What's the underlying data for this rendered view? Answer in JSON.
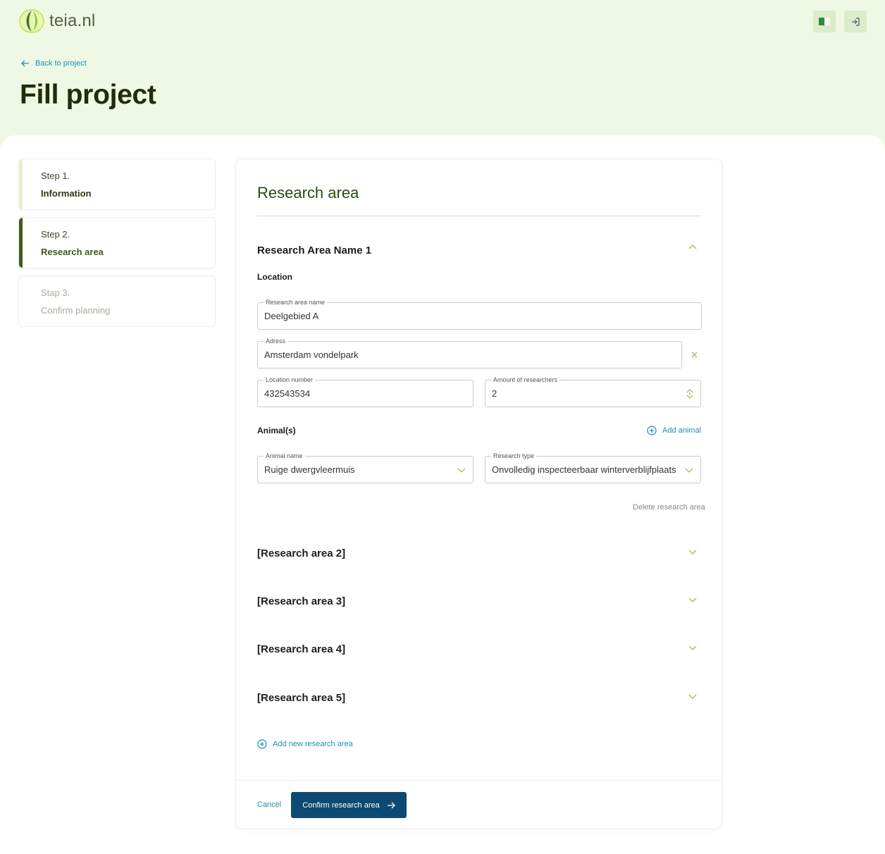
{
  "brand": {
    "name": "teia.nl"
  },
  "header": {
    "language_icon": "flag-icon",
    "logout_icon": "logout-icon",
    "back_label": "Back to project",
    "page_title": "Fill project"
  },
  "steps": [
    {
      "number": "Step 1.",
      "label": "Information",
      "state": "done"
    },
    {
      "number": "Step 2.",
      "label": "Research area",
      "state": "active"
    },
    {
      "number": "Stap 3.",
      "label": "Confirm planning",
      "state": "todo"
    }
  ],
  "card": {
    "title": "Research area",
    "area1": {
      "title": "Research Area Name 1",
      "location_label": "Location",
      "fields": {
        "name": {
          "label": "Research area name",
          "value": "Deelgebied A"
        },
        "address": {
          "label": "Adress",
          "value": "Amsterdam vondelpark"
        },
        "location_number": {
          "label": "Location number",
          "value": "432543534"
        },
        "researchers": {
          "label": "Amount of  researchers",
          "value": "2"
        }
      },
      "animals_label": "Animal(s)",
      "add_animal": "Add animal",
      "animal_name": {
        "label": "Animal name",
        "value": "Ruige dwergvleermuis"
      },
      "research_type": {
        "label": "Research type",
        "value": "Onvolledig inspecteerbaar winterverblijfplaats"
      },
      "delete": "Delete research area"
    },
    "collapsed_areas": [
      "[Research area 2]",
      "[Research area 3]",
      "[Research area 4]",
      "[Research area 5]"
    ],
    "add_new": "Add new research area",
    "cancel": "Cancel",
    "confirm": "Confirm research area"
  },
  "colors": {
    "header_bg": "#eef8e4",
    "brand_dark": "#1e2d0c",
    "link_blue": "#1f8cb8",
    "primary_button": "#0c4a73",
    "accent_green": "#3f5a1d"
  }
}
